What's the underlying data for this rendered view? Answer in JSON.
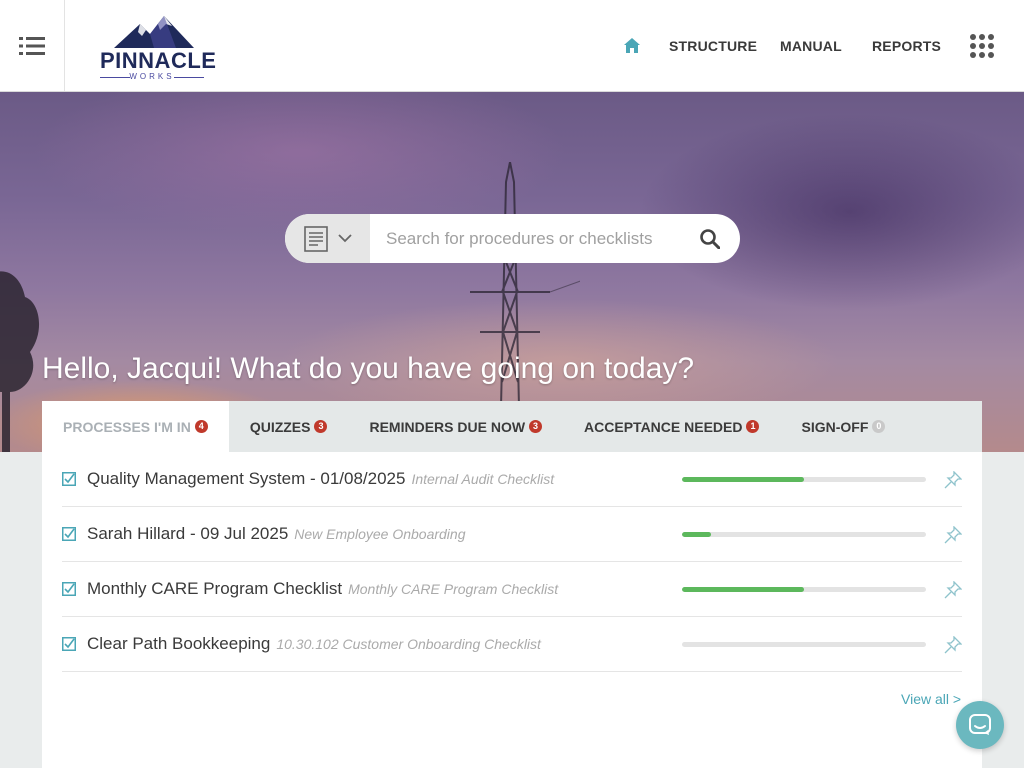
{
  "brand": {
    "name": "PINNACLE",
    "tagline": "WORKS",
    "accent": "#4aa6b6",
    "logo_mountain_dark": "#1f2a5a",
    "logo_mountain_light": "#4a4aa0"
  },
  "header": {
    "menu_icon": "list-icon",
    "home_icon": "home-icon",
    "nav": [
      "STRUCTURE",
      "MANUAL",
      "REPORTS"
    ],
    "apps_icon": "grid-dots-icon"
  },
  "search": {
    "type_icon": "document-icon",
    "placeholder": "Search for procedures or checklists",
    "value": ""
  },
  "greeting": "Hello, Jacqui! What do you have going on today?",
  "tabs": [
    {
      "label": "PROCESSES I'M IN",
      "count": "4",
      "active": true
    },
    {
      "label": "QUIZZES",
      "count": "3",
      "active": false
    },
    {
      "label": "REMINDERS DUE NOW",
      "count": "3",
      "active": false
    },
    {
      "label": "ACCEPTANCE NEEDED",
      "count": "1",
      "active": false
    },
    {
      "label": "SIGN-OFF",
      "count": "0",
      "active": false
    }
  ],
  "processes": [
    {
      "title": "Quality Management System - 01/08/2025",
      "checklist": "Internal Audit Checklist",
      "progress": 0.5
    },
    {
      "title": "Sarah Hillard - 09 Jul 2025",
      "checklist": "New Employee Onboarding",
      "progress": 0.12
    },
    {
      "title": "Monthly CARE Program Checklist",
      "checklist": "Monthly CARE Program Checklist",
      "progress": 0.5
    },
    {
      "title": "Clear Path Bookkeeping",
      "checklist": "10.30.102 Customer Onboarding Checklist",
      "progress": 0
    }
  ],
  "view_all": "View all >",
  "colors": {
    "badge": "#c0392b",
    "progress": "#5cb85c",
    "chat": "#6bb8bf"
  }
}
